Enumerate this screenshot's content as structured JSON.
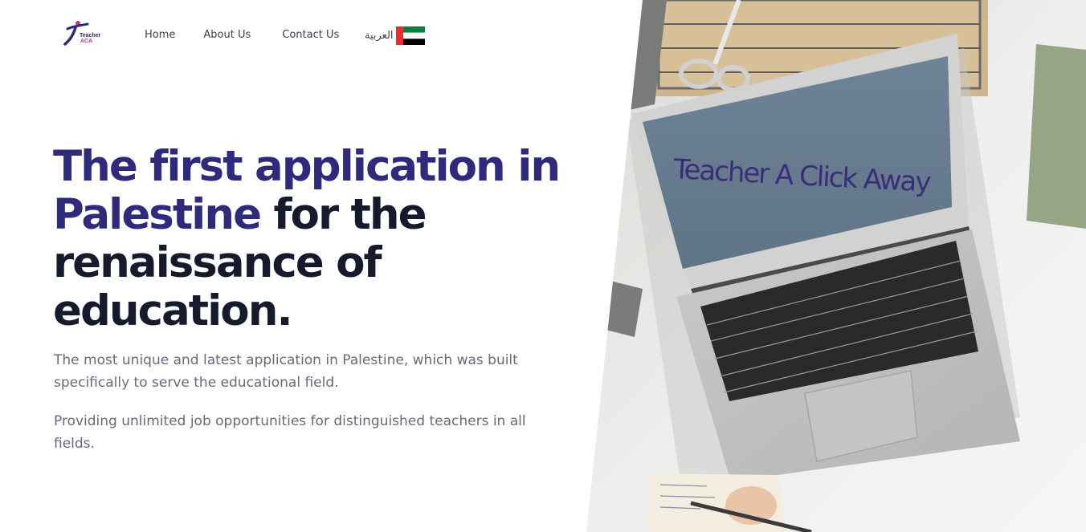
{
  "brand": {
    "logo_line1": "Teacher",
    "logo_line2": "ACA",
    "primary_color": "#2f2a7b",
    "accent_color": "#c2378a"
  },
  "nav": {
    "home": "Home",
    "about": "About Us",
    "contact": "Contact Us",
    "language": "العربية",
    "flag_icon": "uae-flag-icon"
  },
  "hero": {
    "title_highlight": "The first application in Palestine",
    "title_rest": " for the renaissance of education.",
    "desc_1": "The most unique and latest application in Palestine, which was built specifically to serve the educational field.",
    "desc_2": "Providing unlimited job opportunities for distinguished teachers in all fields.",
    "screen_text": "Teacher A Click Away"
  }
}
